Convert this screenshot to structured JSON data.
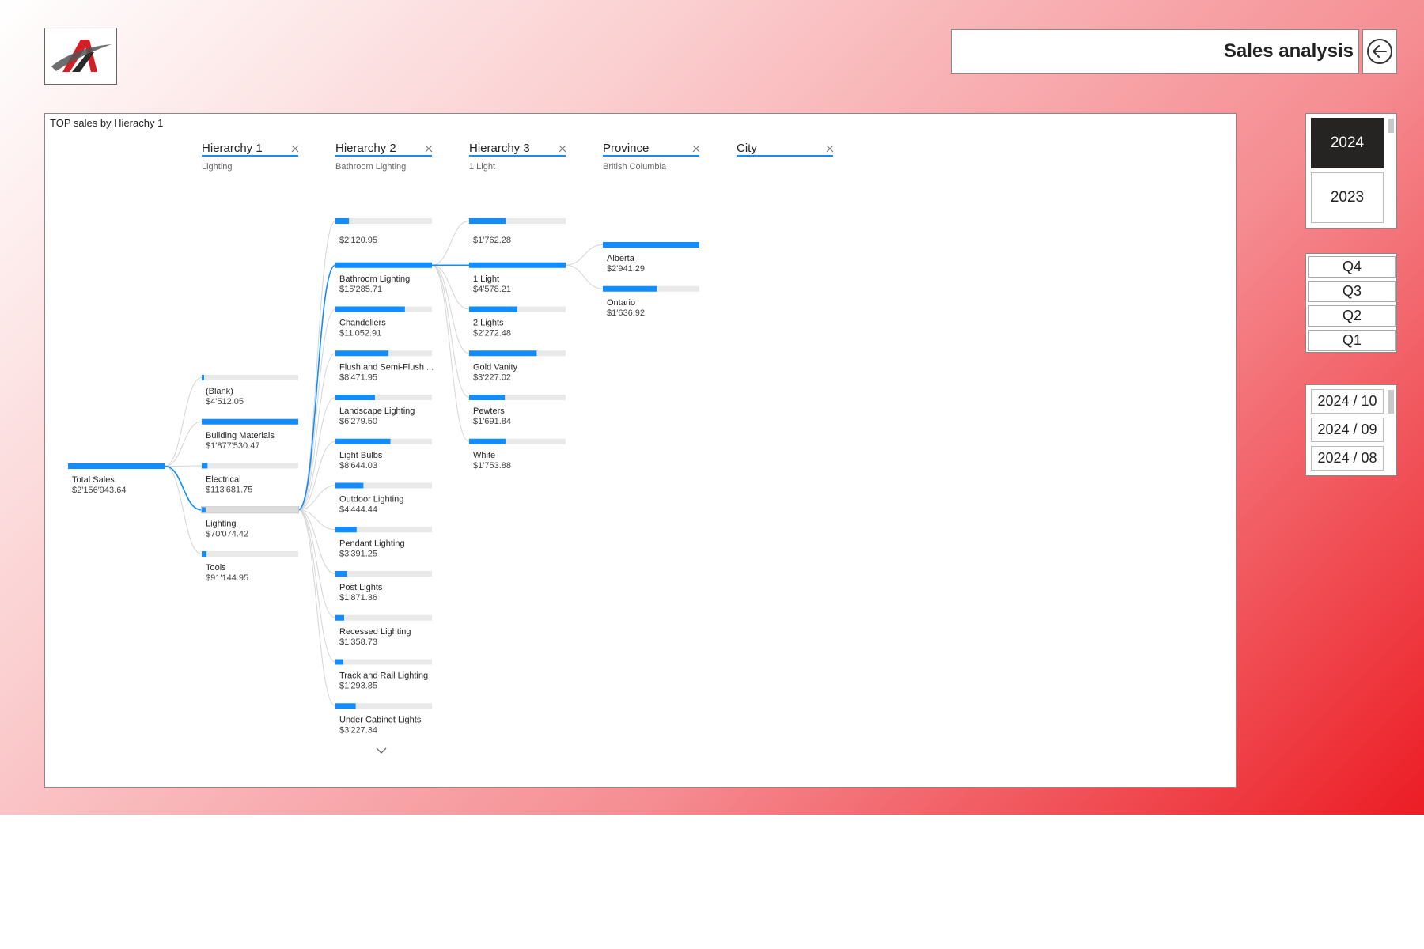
{
  "header": {
    "title": "Sales analysis",
    "back_icon": "arrow-left-circle-icon"
  },
  "logo": {
    "name": "company-logo"
  },
  "visual": {
    "title": "TOP sales by Hierachy 1",
    "levels": [
      {
        "name": "Hierarchy 1",
        "selected": "Lighting"
      },
      {
        "name": "Hierarchy 2",
        "selected": "Bathroom Lighting"
      },
      {
        "name": "Hierarchy 3",
        "selected": "1 Light"
      },
      {
        "name": "Province",
        "selected": "British Columbia"
      },
      {
        "name": "City",
        "selected": ""
      }
    ],
    "expand_more_icon": "chevron-down-icon"
  },
  "chart_data": {
    "type": "decomposition-tree",
    "root": {
      "label": "Total Sales",
      "value": "$2'156'943.64",
      "fill": 1.0
    },
    "columns": [
      {
        "level": "Hierarchy 1",
        "expanded_index": 3,
        "nodes": [
          {
            "label": "(Blank)",
            "value": "$4'512.05",
            "fill": 0.0
          },
          {
            "label": "Building Materials",
            "value": "$1'877'530.47",
            "fill": 1.0
          },
          {
            "label": "Electrical",
            "value": "$113'681.75",
            "fill": 0.06
          },
          {
            "label": "Lighting",
            "value": "$70'074.42",
            "fill": 0.04
          },
          {
            "label": "Tools",
            "value": "$91'144.95",
            "fill": 0.05
          }
        ]
      },
      {
        "level": "Hierarchy 2",
        "expanded_index": 1,
        "nodes": [
          {
            "label": "",
            "value": "$2'120.95",
            "fill": 0.14
          },
          {
            "label": "Bathroom Lighting",
            "value": "$15'285.71",
            "fill": 1.0
          },
          {
            "label": "Chandeliers",
            "value": "$11'052.91",
            "fill": 0.72
          },
          {
            "label": "Flush and Semi-Flush ...",
            "value": "$8'471.95",
            "fill": 0.55
          },
          {
            "label": "Landscape Lighting",
            "value": "$6'279.50",
            "fill": 0.41
          },
          {
            "label": "Light Bulbs",
            "value": "$8'644.03",
            "fill": 0.57
          },
          {
            "label": "Outdoor Lighting",
            "value": "$4'444.44",
            "fill": 0.29
          },
          {
            "label": "Pendant Lighting",
            "value": "$3'391.25",
            "fill": 0.22
          },
          {
            "label": "Post Lights",
            "value": "$1'871.36",
            "fill": 0.12
          },
          {
            "label": "Recessed Lighting",
            "value": "$1'358.73",
            "fill": 0.09
          },
          {
            "label": "Track and Rail Lighting",
            "value": "$1'293.85",
            "fill": 0.08
          },
          {
            "label": "Under Cabinet Lights",
            "value": "$3'227.34",
            "fill": 0.21
          }
        ]
      },
      {
        "level": "Hierarchy 3",
        "expanded_index": 1,
        "nodes": [
          {
            "label": "",
            "value": "$1'762.28",
            "fill": 0.38
          },
          {
            "label": "1 Light",
            "value": "$4'578.21",
            "fill": 1.0
          },
          {
            "label": "2 Lights",
            "value": "$2'272.48",
            "fill": 0.5
          },
          {
            "label": "Gold Vanity",
            "value": "$3'227.02",
            "fill": 0.7
          },
          {
            "label": "Pewters",
            "value": "$1'691.84",
            "fill": 0.37
          },
          {
            "label": "White",
            "value": "$1'753.88",
            "fill": 0.38
          }
        ]
      },
      {
        "level": "Province",
        "expanded_index": -1,
        "nodes": [
          {
            "label": "Alberta",
            "value": "$2'941.29",
            "fill": 1.0
          },
          {
            "label": "Ontario",
            "value": "$1'636.92",
            "fill": 0.56
          }
        ]
      }
    ]
  },
  "slicers": {
    "years": [
      {
        "label": "2024",
        "selected": true
      },
      {
        "label": "2023",
        "selected": false
      }
    ],
    "quarters": [
      "Q4",
      "Q3",
      "Q2",
      "Q1"
    ],
    "months": [
      "2024 / 10",
      "2024 / 09",
      "2024 / 08"
    ]
  },
  "colors": {
    "bar_fill": "#118dff",
    "bar_track": "#e9e9e9",
    "link": "#118dff",
    "link_faint": "#d5d5d5",
    "header_underline": "#118dff",
    "selected_year_bg": "#252423"
  }
}
